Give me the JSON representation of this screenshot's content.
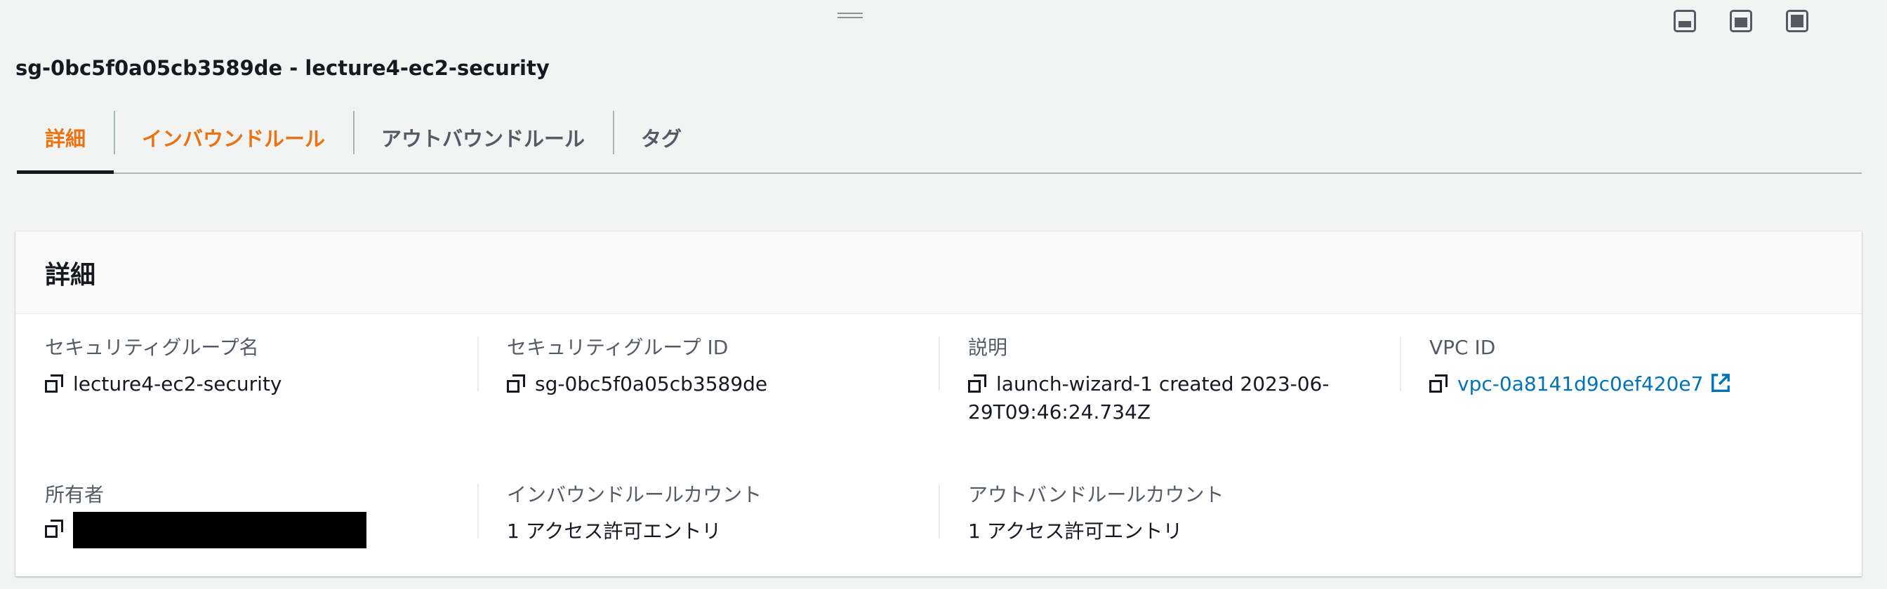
{
  "page": {
    "title": "sg-0bc5f0a05cb3589de - lecture4-ec2-security"
  },
  "panel_controls": [
    {
      "icon": "panel-bottom-icon"
    },
    {
      "icon": "panel-middle-icon"
    },
    {
      "icon": "panel-full-icon"
    }
  ],
  "tabs": [
    {
      "label": "詳細",
      "active": true
    },
    {
      "label": "インバウンドルール",
      "active": false
    },
    {
      "label": "アウトバウンドルール",
      "active": false
    },
    {
      "label": "タグ",
      "active": false
    }
  ],
  "details": {
    "title": "詳細",
    "security_group_name": {
      "label": "セキュリティグループ名",
      "value": "lecture4-ec2-security"
    },
    "security_group_id": {
      "label": "セキュリティグループ ID",
      "value": "sg-0bc5f0a05cb3589de"
    },
    "description": {
      "label": "説明",
      "value_line1": "launch-wizard-1 created 2023-06-",
      "value_line2": "29T09:46:24.734Z"
    },
    "vpc_id": {
      "label": "VPC ID",
      "value": "vpc-0a8141d9c0ef420e7"
    },
    "owner": {
      "label": "所有者"
    },
    "inbound_rule_count": {
      "label": "インバウンドルールカウント",
      "value": "1 アクセス許可エントリ"
    },
    "outbound_rule_count": {
      "label": "アウトバンドルールカウント",
      "value": "1 アクセス許可エントリ"
    }
  },
  "colors": {
    "accent": "#ec7211",
    "link": "#0073bb",
    "background": "#f2f3f3"
  }
}
